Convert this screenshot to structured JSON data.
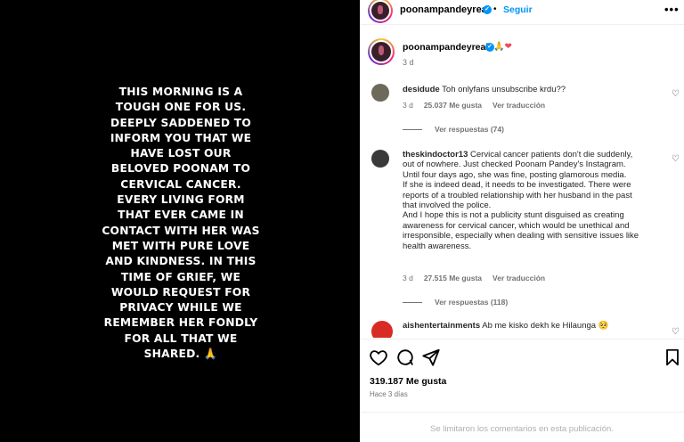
{
  "story": {
    "text": "THIS MORNING IS A\nTOUGH ONE FOR US.\nDEEPLY SADDENED TO\nINFORM YOU THAT WE\nHAVE LOST OUR\nBELOVED POONAM TO\nCERVICAL CANCER.\nEVERY LIVING FORM\nTHAT EVER CAME IN\nCONTACT WITH HER WAS\nMET WITH PURE LOVE\nAND KINDNESS. IN THIS\nTIME OF GRIEF, WE\nWOULD REQUEST FOR\nPRIVACY WHILE WE\nREMEMBER HER FONDLY\nFOR ALL THAT WE\nSHARED. 🙏"
  },
  "header": {
    "username": "poonampandeyreal",
    "separator": "•",
    "follow_label": "Seguir",
    "more_label": "•••"
  },
  "caption": {
    "username": "poonampandeyreal",
    "emoji_pray": "🙏",
    "emoji_heart": "❤",
    "time": "3 d"
  },
  "comments": [
    {
      "username": "desidude",
      "text": "Toh onlyfans unsubscribe krdu??",
      "time": "3 d",
      "likes": "25.037 Me gusta",
      "reply_label": "Ver traducción",
      "view_replies": "Ver respuestas (74)"
    },
    {
      "username": "theskindoctor13",
      "text_lines": [
        "Cervical cancer patients don't die suddenly,",
        "out of nowhere. Just checked Poonam Pandey's Instagram.",
        "Until four days ago, she was fine, posting glamorous media.",
        "If she is indeed dead, it needs to be investigated. There were",
        "reports of a troubled relationship with her husband in the past",
        "that involved the police.",
        "And I hope this is not a publicity stunt disguised as creating",
        "awareness for cervical cancer, which would be unethical and",
        "irresponsible, especially when dealing with sensitive issues like",
        "health awareness."
      ],
      "time": "3 d",
      "likes": "27.515 Me gusta",
      "reply_label": "Ver traducción",
      "view_replies": "Ver respuestas (118)"
    },
    {
      "username": "aishentertainments",
      "text": "Ab me kisko dekh ke Hilaunga 🥺"
    }
  ],
  "footer": {
    "likes": "319.187 Me gusta",
    "ago": "Hace 3 días",
    "comments_limited": "Se limitaron los comentarios en esta publicación."
  },
  "icons": {
    "heart": "heart-icon",
    "comment": "comment-icon",
    "share": "share-icon",
    "save": "bookmark-icon"
  },
  "colors": {
    "accent": "#0095f6",
    "heart": "#ed4956"
  }
}
